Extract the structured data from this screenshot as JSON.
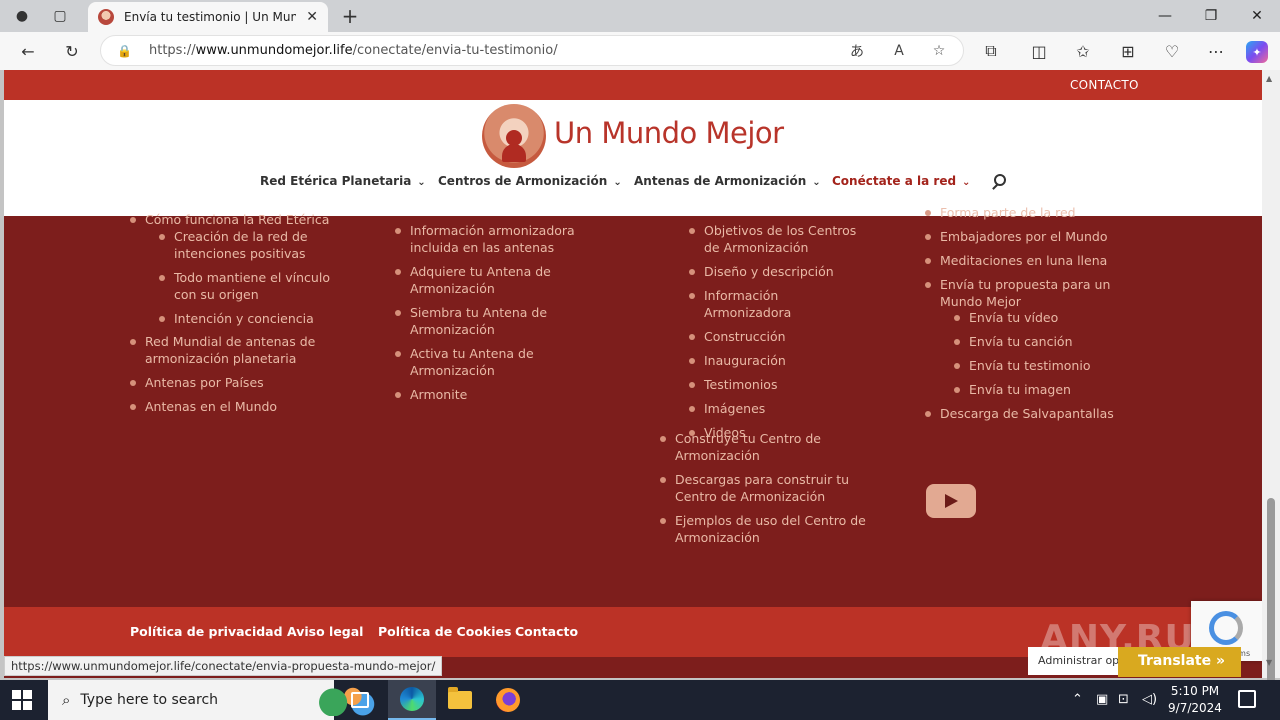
{
  "browser": {
    "tab_title": "Envía tu testimonio | Un Mundo Mejor",
    "url_prefix": "https://",
    "url_domain": "www.unmundomejor.life",
    "url_path": "/conectate/envia-tu-testimonio/",
    "status_url": "https://www.unmundomejor.life/conectate/envia-propuesta-mundo-mejor/"
  },
  "site": {
    "topbar_contact": "CONTACTO",
    "logo_text": "Un Mundo Mejor",
    "menu": [
      {
        "label": "Red Etérica Planetaria"
      },
      {
        "label": "Centros de Armonización"
      },
      {
        "label": "Antenas de Armonización"
      },
      {
        "label": "Conéctate a la red"
      }
    ]
  },
  "footer": {
    "col1": {
      "clipped_top": "Cómo funciona la Red Etérica",
      "sub": [
        "Creación de la red de intenciones positivas",
        "Todo mantiene el vínculo con su origen",
        "Intención y conciencia"
      ],
      "items": [
        "Red Mundial de antenas de armonización planetaria",
        "Antenas por Países",
        "Antenas en el Mundo"
      ]
    },
    "col2": {
      "items": [
        "Información armonizadora incluida en las antenas",
        "Adquiere tu Antena de Armonización",
        "Siembra tu Antena de Armonización",
        "Activa tu Antena de Armonización",
        "Armonite"
      ]
    },
    "col3": {
      "sub": [
        "Objetivos de los Centros de Armonización",
        "Diseño y descripción",
        "Información Armonizadora",
        "Construcción",
        "Inauguración",
        "Testimonios",
        "Imágenes",
        "Videos"
      ],
      "items": [
        "Construye tu Centro de Armonización",
        "Descargas para construir tu Centro de Armonización",
        "Ejemplos de uso del Centro de Armonización"
      ]
    },
    "col4": {
      "clipped_top": "Forma parte de la red",
      "items_a": [
        "Embajadores por el Mundo",
        "Meditaciones en luna llena",
        "Envía tu propuesta para un Mundo Mejor"
      ],
      "sub": [
        "Envía tu vídeo",
        "Envía tu canción",
        "Envía tu testimonio",
        "Envía tu imagen"
      ],
      "items_b": [
        "Descarga de Salvapantallas"
      ]
    },
    "bottom_links": [
      "Política de privacidad",
      "Aviso legal",
      "Política de Cookies",
      "Contacto"
    ]
  },
  "overlays": {
    "admin_text": "Administrar opciones",
    "translate_label": "Translate »",
    "recaptcha_terms": "rms",
    "watermark": "ANY.RUN"
  },
  "taskbar": {
    "search_placeholder": "Type here to search",
    "time": "5:10 PM",
    "date": "9/7/2024"
  },
  "colors": {
    "topbar_red": "#bb3226",
    "footer_dark_red": "#7d1e1c",
    "link_pink": "#e9b9a6",
    "active_menu": "#a3231b"
  },
  "icons": [
    "profile-icon",
    "tabs-icon",
    "back-icon",
    "refresh-icon",
    "lock-icon",
    "read-aloud-icon",
    "favorite-icon",
    "extensions-icon",
    "split-screen-icon",
    "favorites-icon",
    "collections-icon",
    "more-icon",
    "copilot-icon",
    "youtube-icon",
    "search-icon"
  ]
}
